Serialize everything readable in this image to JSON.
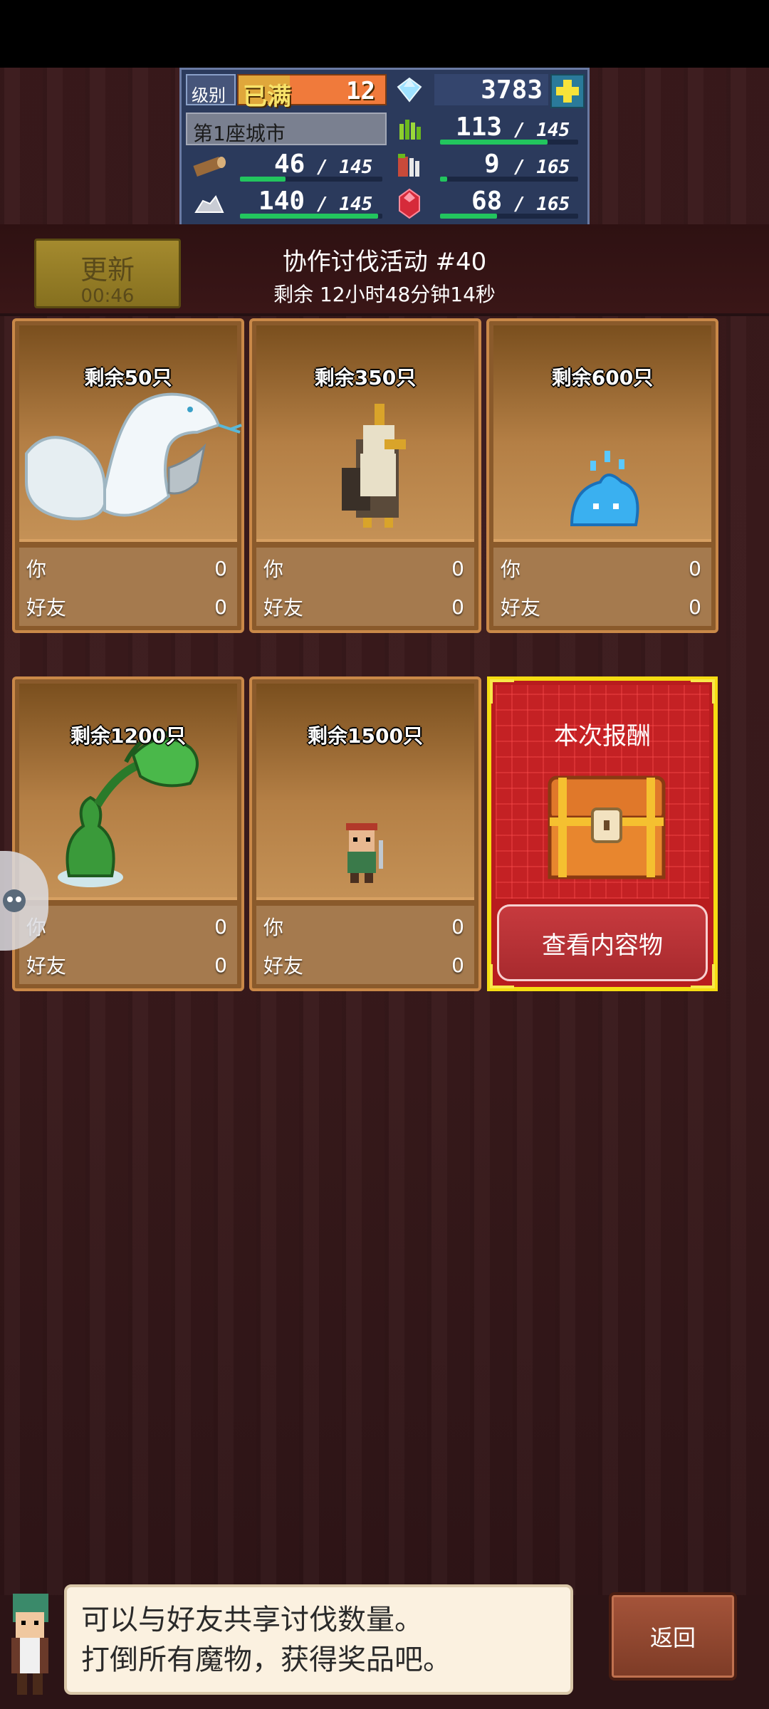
{
  "hud": {
    "level_label": "级别",
    "level_status": "已满",
    "level_value": "12",
    "gems": "3783",
    "plus_icon": "plus-icon",
    "city_name": "第1座城市",
    "resources": [
      {
        "name": "grass",
        "icon": "grass-icon",
        "current": "113",
        "max": "145",
        "fill": 0.78
      },
      {
        "name": "wood",
        "icon": "wood-icon",
        "current": "46",
        "max": "145",
        "fill": 0.32
      },
      {
        "name": "food",
        "icon": "food-icon",
        "current": "9",
        "max": "165",
        "fill": 0.05
      },
      {
        "name": "ore",
        "icon": "ore-icon",
        "current": "140",
        "max": "145",
        "fill": 0.97
      },
      {
        "name": "ruby",
        "icon": "ruby-icon",
        "current": "68",
        "max": "165",
        "fill": 0.41
      }
    ]
  },
  "event": {
    "update_label": "更新",
    "update_timer": "00:46",
    "title": "协作讨伐活动 #40",
    "remaining": "剩余 12小时48分钟14秒"
  },
  "cards": [
    {
      "remain": "剩余50只",
      "monster": "white-serpent",
      "you_label": "你",
      "you": "0",
      "friend_label": "好友",
      "friend": "0"
    },
    {
      "remain": "剩余350只",
      "monster": "crested-bird",
      "you_label": "你",
      "you": "0",
      "friend_label": "好友",
      "friend": "0"
    },
    {
      "remain": "剩余600只",
      "monster": "blue-slime",
      "you_label": "你",
      "you": "0",
      "friend_label": "好友",
      "friend": "0"
    },
    {
      "remain": "剩余1200只",
      "monster": "green-plant",
      "you_label": "你",
      "you": "0",
      "friend_label": "好友",
      "friend": "0"
    },
    {
      "remain": "剩余1500只",
      "monster": "bandit",
      "you_label": "你",
      "you": "0",
      "friend_label": "好友",
      "friend": "0"
    }
  ],
  "reward": {
    "title": "本次报酬",
    "button": "查看内容物"
  },
  "dialog": {
    "line1": "可以与好友共享讨伐数量。",
    "line2": "打倒所有魔物，获得奖品吧。"
  },
  "back_label": "返回",
  "colors": {
    "bar_green": "#22c55e",
    "reward_red": "#b81c1e",
    "reward_gold": "#f5dc12",
    "level_orange": "#f07a3b"
  }
}
